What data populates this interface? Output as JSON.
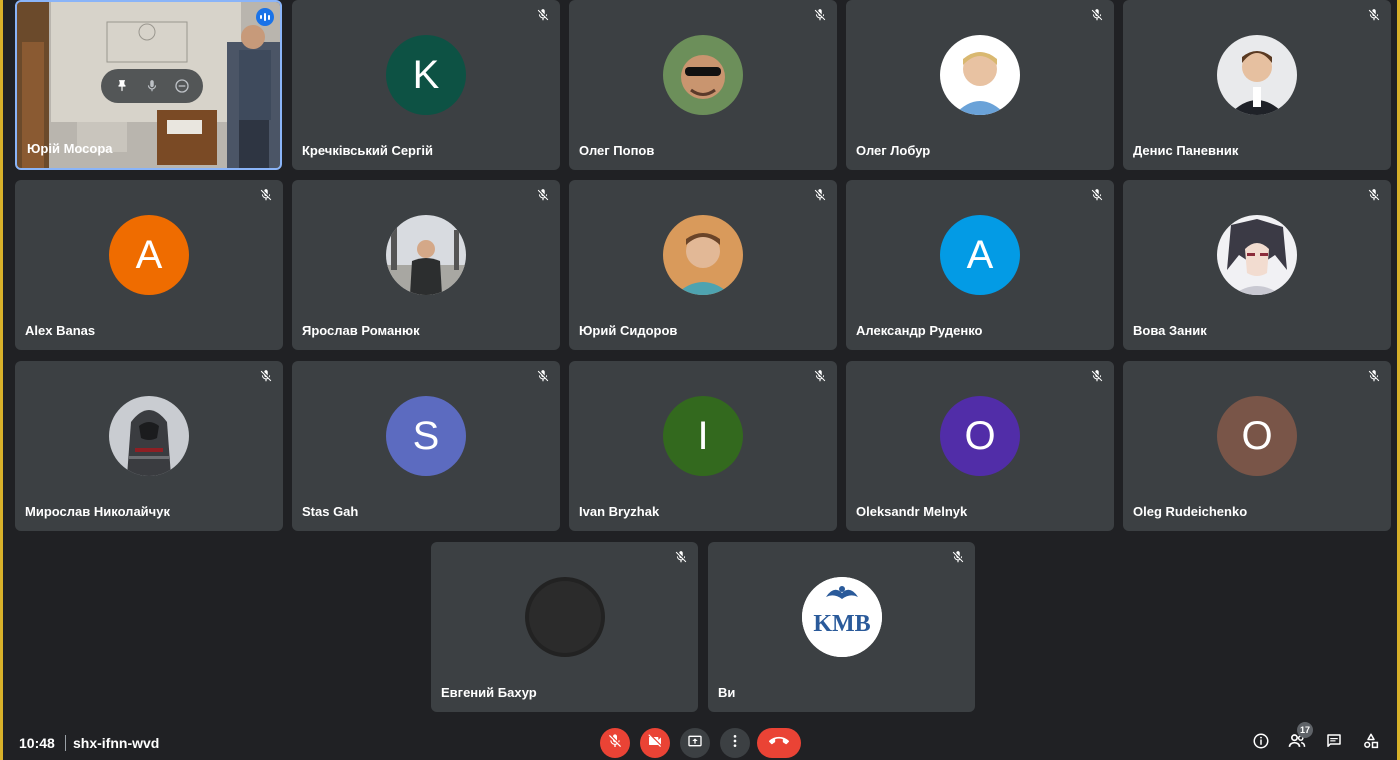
{
  "participants": [
    {
      "name": "Юрій Мосора",
      "type": "video"
    },
    {
      "name": "Кречківський Сергій",
      "initial": "K",
      "color": "#0d5244"
    },
    {
      "name": "Олег Попов",
      "type": "photo"
    },
    {
      "name": "Олег Лобур",
      "type": "photo"
    },
    {
      "name": "Денис Паневник",
      "type": "photo"
    },
    {
      "name": "Alex Banas",
      "initial": "A",
      "color": "#ef6c00"
    },
    {
      "name": "Ярослав Романюк",
      "type": "photo"
    },
    {
      "name": "Юрий Сидоров",
      "type": "photo"
    },
    {
      "name": "Александр Руденко",
      "initial": "A",
      "color": "#039be5"
    },
    {
      "name": "Вова Заник",
      "type": "photo"
    },
    {
      "name": "Мирослав Николайчук",
      "type": "photo"
    },
    {
      "name": "Stas Gah",
      "initial": "S",
      "color": "#5c6bc0"
    },
    {
      "name": "Ivan Bryzhak",
      "initial": "I",
      "color": "#33691e"
    },
    {
      "name": "Oleksandr Melnyk",
      "initial": "O",
      "color": "#512da8"
    },
    {
      "name": "Oleg Rudeichenko",
      "initial": "O",
      "color": "#795548"
    },
    {
      "name": "Евгений Бахур",
      "type": "photo"
    },
    {
      "name": "Ви",
      "type": "logo",
      "logo_text": "KMB"
    }
  ],
  "bottom_bar": {
    "time": "10:48",
    "meeting_code": "shx-ifnn-wvd",
    "participant_count": "17"
  },
  "icons": {
    "mute": "mic-off-icon",
    "pin": "pin-icon",
    "mic": "mic-icon",
    "remove": "remove-icon",
    "camera_off": "camera-off-icon",
    "present": "present-screen-icon",
    "more": "more-vert-icon",
    "hangup": "call-end-icon",
    "info": "info-icon",
    "people": "people-icon",
    "chat": "chat-icon",
    "activities": "activities-icon"
  },
  "colors": {
    "background": "#202124",
    "tile": "#3c4043",
    "danger": "#ea4335",
    "accent": "#1a73e8"
  }
}
